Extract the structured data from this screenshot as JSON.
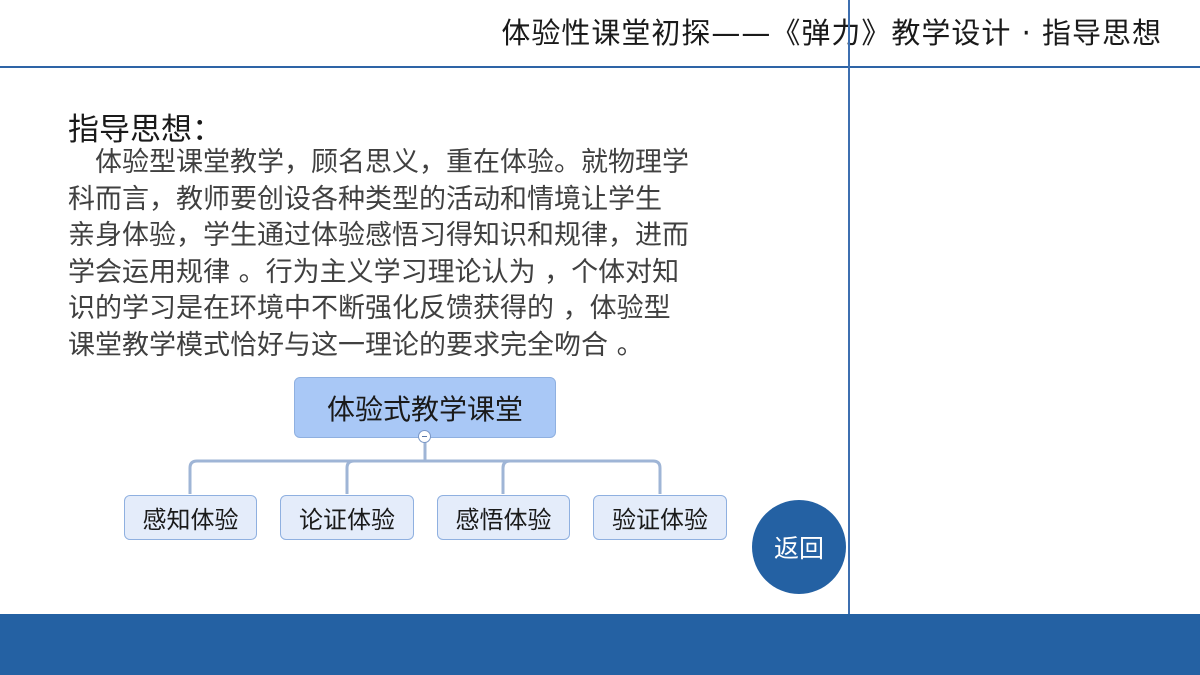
{
  "header": {
    "title": "体验性课堂初探——《弹力》教学设计 · 指导思想"
  },
  "content": {
    "heading": "指导思想：",
    "paragraph_lines": [
      "　体验型课堂教学，顾名思义，重在体验。就物理学",
      "科而言，教师要创设各种类型的活动和情境让学生",
      "亲身体验，学生通过体验感悟习得知识和规律，进而",
      "学会运用规律 。行为主义学习理论认为 ，个体对知",
      "识的学习是在环境中不断强化反馈获得的 ，体验型",
      "课堂教学模式恰好与这一理论的要求完全吻合 。"
    ]
  },
  "mindmap": {
    "root": "体验式教学课堂",
    "children": [
      "感知体验",
      "论证体验",
      "感悟体验",
      "验证体验"
    ]
  },
  "back_button": {
    "label": "返回"
  }
}
